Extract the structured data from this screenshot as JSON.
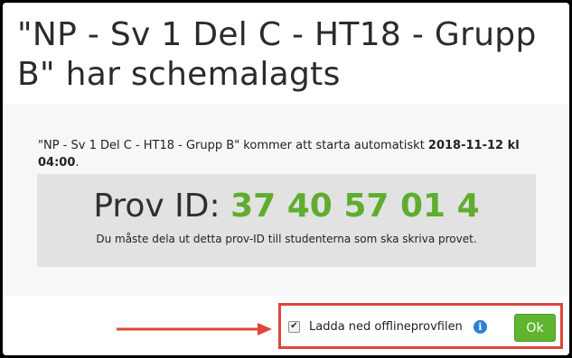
{
  "dialog": {
    "title": "\"NP - Sv 1 Del C - HT18 - Grupp B\" har schemalagts",
    "message_prefix": "\"NP - Sv 1 Del C - HT18 - Grupp B\" kommer att starta automatiskt ",
    "message_datetime": "2018-11-12 kl 04:00",
    "message_suffix": ".",
    "exam_id_label": "Prov ID: ",
    "exam_id_value": "37 40 57 01 4",
    "exam_id_note": "Du måste dela ut detta prov-ID till studenterna som ska skriva provet.",
    "checkbox_label": "Ladda ned offlineprovfilen",
    "checkbox_checked": true,
    "ok_label": "Ok"
  },
  "icons": {
    "checkbox_icon": "checkmark-icon",
    "info_icon": "info-icon",
    "arrow_icon": "arrow-right-icon"
  },
  "colors": {
    "accent_green": "#5fb530",
    "id_green": "#5fad2e",
    "annotation_red": "#e0453a",
    "info_blue": "#2b7fd4"
  }
}
